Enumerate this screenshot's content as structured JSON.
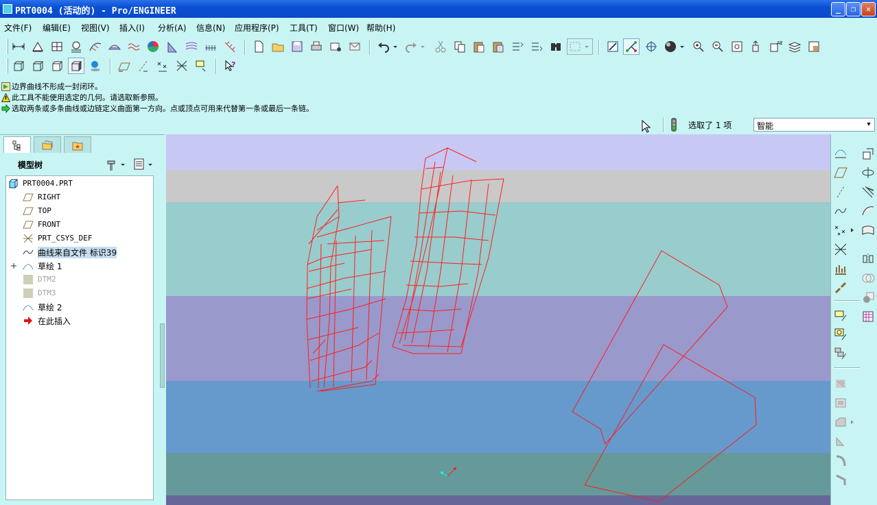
{
  "window": {
    "title": "PRT0004 (活动的) - Pro/ENGINEER",
    "minimize": "_",
    "restore": "❐",
    "close": "✕"
  },
  "menu": [
    "文件(F)",
    "编辑(E)",
    "视图(V)",
    "插入(I)",
    "分析(A)",
    "信息(N)",
    "应用程序(P)",
    "工具(T)",
    "窗口(W)",
    "帮助(H)"
  ],
  "messages": [
    {
      "icon": "info-arrow-icon",
      "text": "边界曲线不形成一封闭环。"
    },
    {
      "icon": "warning-icon",
      "text": "此工具不能使用选定的几何。请选取新参照。"
    },
    {
      "icon": "prompt-arrow-icon",
      "text": "选取两条或多条曲线或边链定义曲面第一方向。点或顶点可用来代替第一条或最后一条链。"
    }
  ],
  "selection": {
    "status": "选取了 1 项",
    "filter": "智能",
    "filter_arrow": "▾"
  },
  "model_tree": {
    "title": "模型树",
    "items": [
      {
        "label": "PRT0004.PRT",
        "icon": "part-icon",
        "expander": ""
      },
      {
        "label": "RIGHT",
        "icon": "datum-plane-icon",
        "expander": ""
      },
      {
        "label": "TOP",
        "icon": "datum-plane-icon",
        "expander": ""
      },
      {
        "label": "FRONT",
        "icon": "datum-plane-icon",
        "expander": ""
      },
      {
        "label": "PRT_CSYS_DEF",
        "icon": "csys-icon",
        "expander": ""
      },
      {
        "label": "曲线来自文件 标识39",
        "icon": "curve-icon",
        "expander": ""
      },
      {
        "label": "草绘 1",
        "icon": "sketch-icon",
        "expander": "+"
      },
      {
        "label": "DTM2",
        "icon": "suppressed-datum-icon",
        "expander": ""
      },
      {
        "label": "DTM3",
        "icon": "suppressed-datum-icon",
        "expander": ""
      },
      {
        "label": "草绘 2",
        "icon": "sketch-icon",
        "expander": ""
      },
      {
        "label": "在此插入",
        "icon": "insert-here-arrow-icon",
        "expander": ""
      }
    ]
  },
  "colors": {
    "background": "#c8f4f4",
    "curve": "#ff2020",
    "title_bar": "#0a50d4"
  },
  "toolbar_row1": [
    "distance-measure-icon",
    "area-measure-icon",
    "diameter-icon",
    "length-icon",
    "curvature-icon",
    "section-icon",
    "offset-analysis-icon",
    "draft-analysis-icon",
    "slope-icon",
    "reflection-icon",
    "shade-check-icon",
    "dihedral-icon",
    "new-file-icon",
    "open-file-icon",
    "save-icon",
    "print-icon",
    "email-icon",
    "email-link-icon",
    "undo-icon",
    "redo-icon",
    "cut-icon",
    "copy-icon",
    "paste-icon",
    "paste-special-icon",
    "regenerate-icon",
    "regen-manager-icon",
    "find-icon",
    "select-box-icon",
    "repaint-icon",
    "spin-center-icon",
    "orient-mode-icon",
    "appearance-icon",
    "zoom-in-icon",
    "zoom-out-icon",
    "refit-icon",
    "orient-icon",
    "saved-views-icon",
    "layers-icon",
    "view-manager-icon"
  ],
  "toolbar_row2": [
    "wireframe-icon",
    "hidden-line-icon",
    "no-hidden-icon",
    "shading-icon",
    "enhanced-realism-icon",
    "datum-plane-display-icon",
    "datum-axis-display-icon",
    "datum-point-display-icon",
    "csys-display-icon",
    "annotation-display-icon",
    "context-help-icon"
  ],
  "right_toolbar": [
    "sketched-curve-icon",
    "datum-plane-tool-icon",
    "datum-axis-tool-icon",
    "datum-curve-icon",
    "datum-point-icon",
    "csys-tool-icon",
    "analysis-feature-icon",
    "chain-icon",
    "edit-pattern-icon",
    "round-set-icon",
    "group-icon",
    "hole-tool-icon",
    "shell-tool-icon",
    "rib-tool-icon",
    "draft-tool-icon",
    "round-tool-icon",
    "chamfer-tool-icon",
    "extrude-tool-icon",
    "revolve-tool-icon",
    "variable-sweep-icon",
    "blend-tool-icon",
    "boundary-blend-icon",
    "mirror-tool-icon",
    "merge-tool-icon",
    "trim-tool-icon",
    "pattern-tool-icon"
  ]
}
